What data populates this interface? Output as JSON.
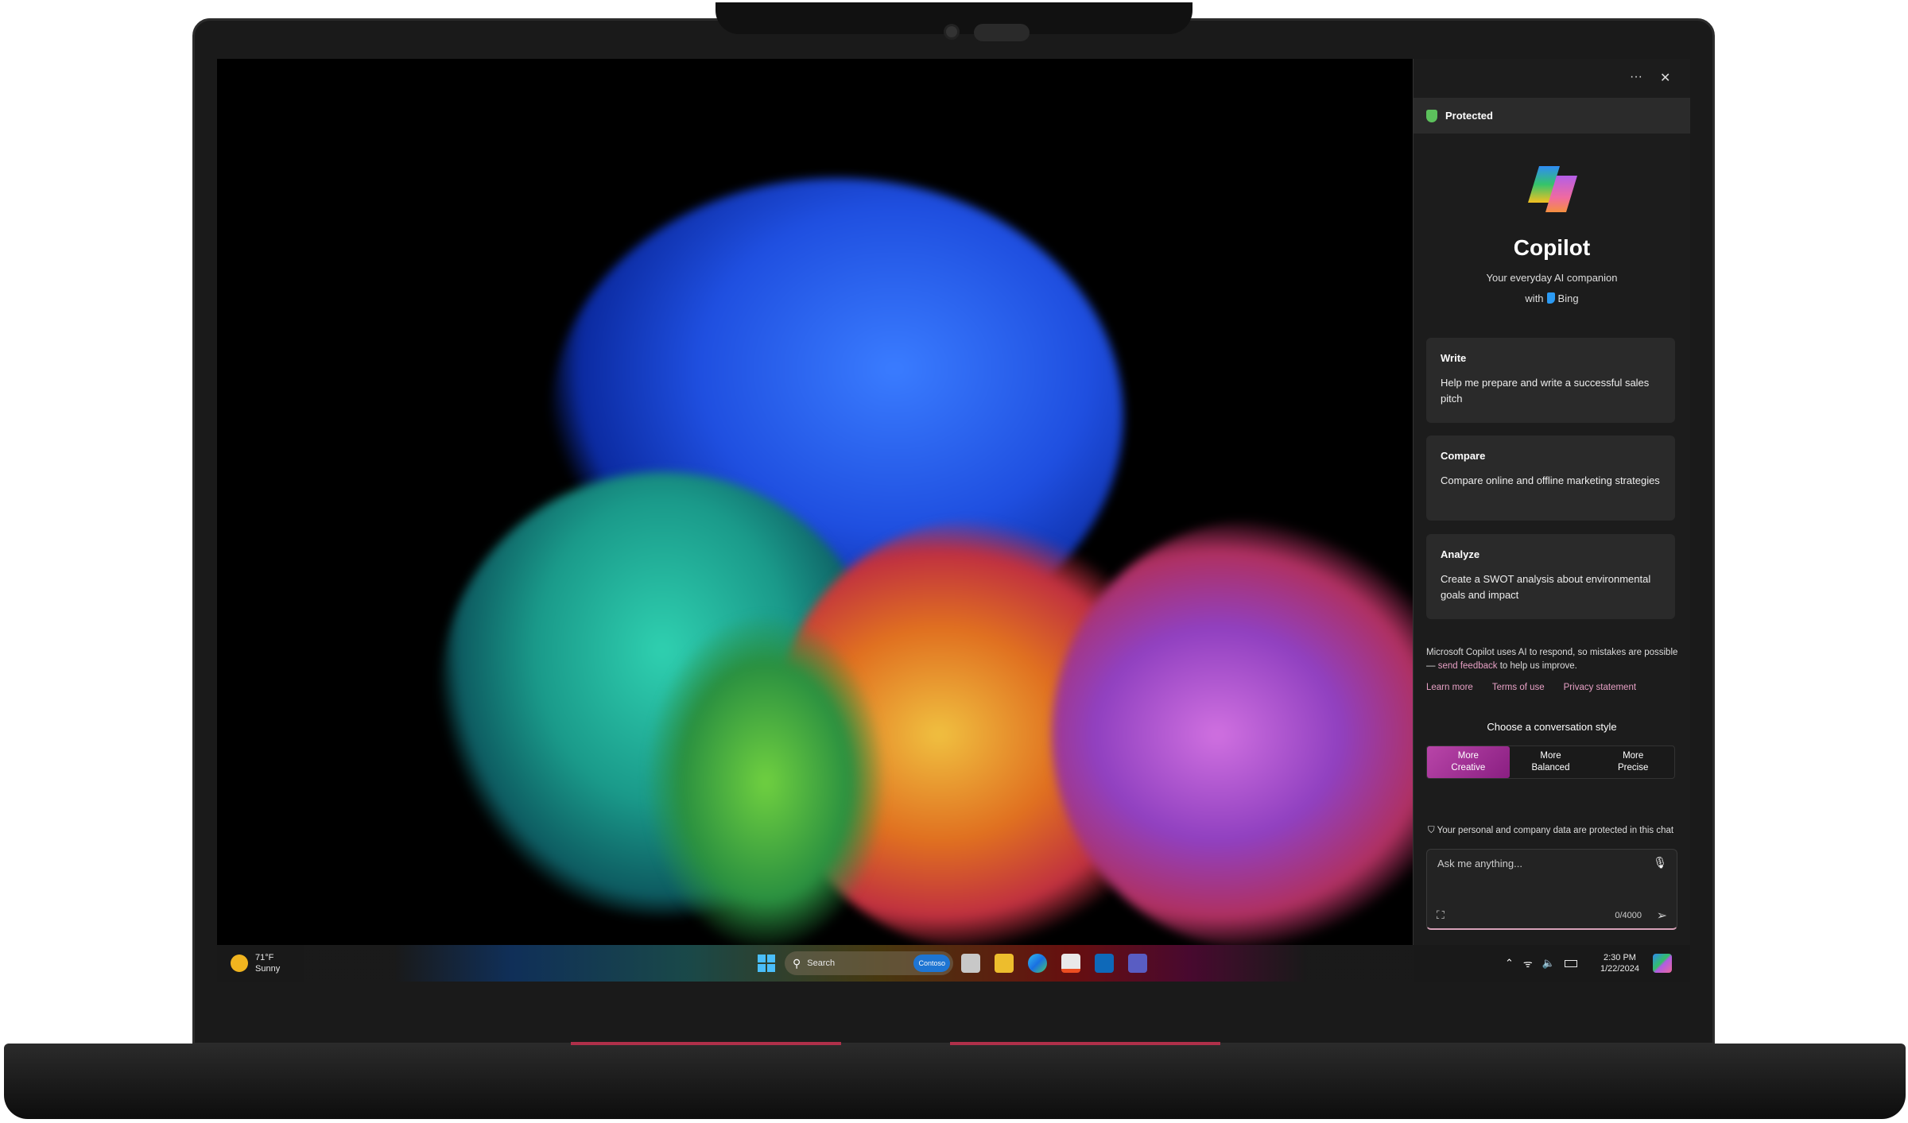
{
  "copilot": {
    "menu_icon": "more-icon",
    "close_icon": "close-icon",
    "protected_label": "Protected",
    "title": "Copilot",
    "tagline": "Your everyday AI companion",
    "with": "with",
    "bing": "Bing",
    "cards": [
      {
        "title": "Write",
        "text": "Help me prepare and write a successful sales pitch"
      },
      {
        "title": "Compare",
        "text": "Compare online and offline marketing strategies"
      },
      {
        "title": "Analyze",
        "text": "Create a SWOT analysis about environmental goals and impact"
      }
    ],
    "disclaimer_pre": "Microsoft Copilot uses AI to respond, so mistakes are possible — ",
    "disclaimer_link": "send feedback",
    "disclaimer_post": " to help us improve.",
    "links": [
      "Learn more",
      "Terms of use",
      "Privacy statement"
    ],
    "style_heading": "Choose a conversation style",
    "styles": [
      {
        "line1": "More",
        "line2": "Creative",
        "selected": true
      },
      {
        "line1": "More",
        "line2": "Balanced"
      },
      {
        "line1": "More",
        "line2": "Precise"
      }
    ],
    "privacy_note": "Your personal and company data are protected in this chat",
    "input_placeholder": "Ask me anything...",
    "char_count": "0/4000",
    "accent": "#a8379c"
  },
  "taskbar": {
    "weather_temp": "71°F",
    "weather_cond": "Sunny",
    "search_placeholder": "Search",
    "search_badge": "Contoso",
    "apps": [
      "task-view-icon",
      "file-explorer-icon",
      "edge-icon",
      "store-icon",
      "outlook-icon",
      "teams-icon"
    ],
    "time": "2:30 PM",
    "date": "1/22/2024"
  }
}
